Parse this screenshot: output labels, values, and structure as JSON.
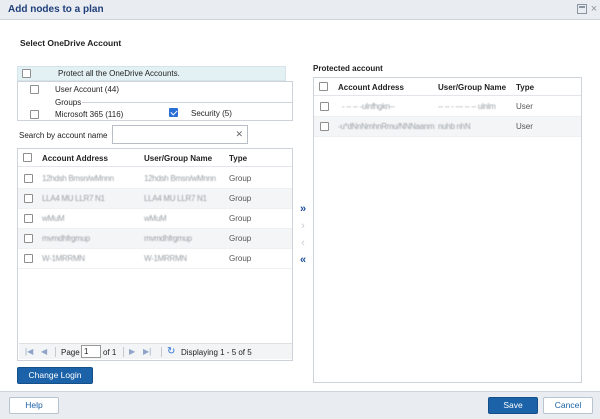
{
  "dialog": {
    "title": "Add nodes to a plan"
  },
  "section_title": "Select OneDrive Account",
  "protect_all": {
    "label": "Protect all the OneDrive Accounts.",
    "checked": false
  },
  "options": {
    "user_account": {
      "label": "User Account (44)",
      "checked": false
    },
    "groups_label": "Groups",
    "microsoft365": {
      "label": "Microsoft 365 (116)",
      "checked": false
    },
    "security": {
      "label": "Security (5)",
      "checked": true
    }
  },
  "search": {
    "label": "Search by account name",
    "value": "",
    "placeholder": "",
    "clear_icon": "close-icon"
  },
  "left_grid": {
    "columns": [
      "Account Address",
      "User/Group Name",
      "Type"
    ],
    "rows": [
      {
        "address": "12hdsh Bmsn/wMnnn",
        "name": "12hdsh Bmsn/wMnnn",
        "type": "Group"
      },
      {
        "address": "LLA4 MU LLR7 N1",
        "name": "LLA4 MU LLR7 N1",
        "type": "Group"
      },
      {
        "address": "wMuM",
        "name": "wMuM",
        "type": "Group"
      },
      {
        "address": "mvmdhfrgmup",
        "name": "mvmdhfrgmup",
        "type": "Group"
      },
      {
        "address": "W-1MRRMN",
        "name": "W-1MRRMN",
        "type": "Group"
      }
    ],
    "pager": {
      "page_label": "Page",
      "page_value": "1",
      "of_label": "of 1",
      "display_text": "Displaying 1 - 5 of 5"
    }
  },
  "move_buttons": {
    "add_all": "»",
    "add": "›",
    "remove": "‹",
    "remove_all": "«"
  },
  "right_grid": {
    "title": "Protected account",
    "columns": [
      "Account Address",
      "User/Group Name",
      "Type"
    ],
    "rows": [
      {
        "address": "- -- -- -ulnfhgkn-- ",
        "name": "-- -- - --- -- -- ulnlm",
        "type": "User"
      },
      {
        "address": "-u*dNnNmhnRmu/NNNaanm",
        "name": "nuhb nhN",
        "type": "User"
      }
    ]
  },
  "buttons": {
    "change_login": "Change Login",
    "help": "Help",
    "save": "Save",
    "cancel": "Cancel"
  },
  "colors": {
    "primary": "#1b62a8",
    "title": "#1f3f7a",
    "highlight_row": "#e3f0f4"
  }
}
